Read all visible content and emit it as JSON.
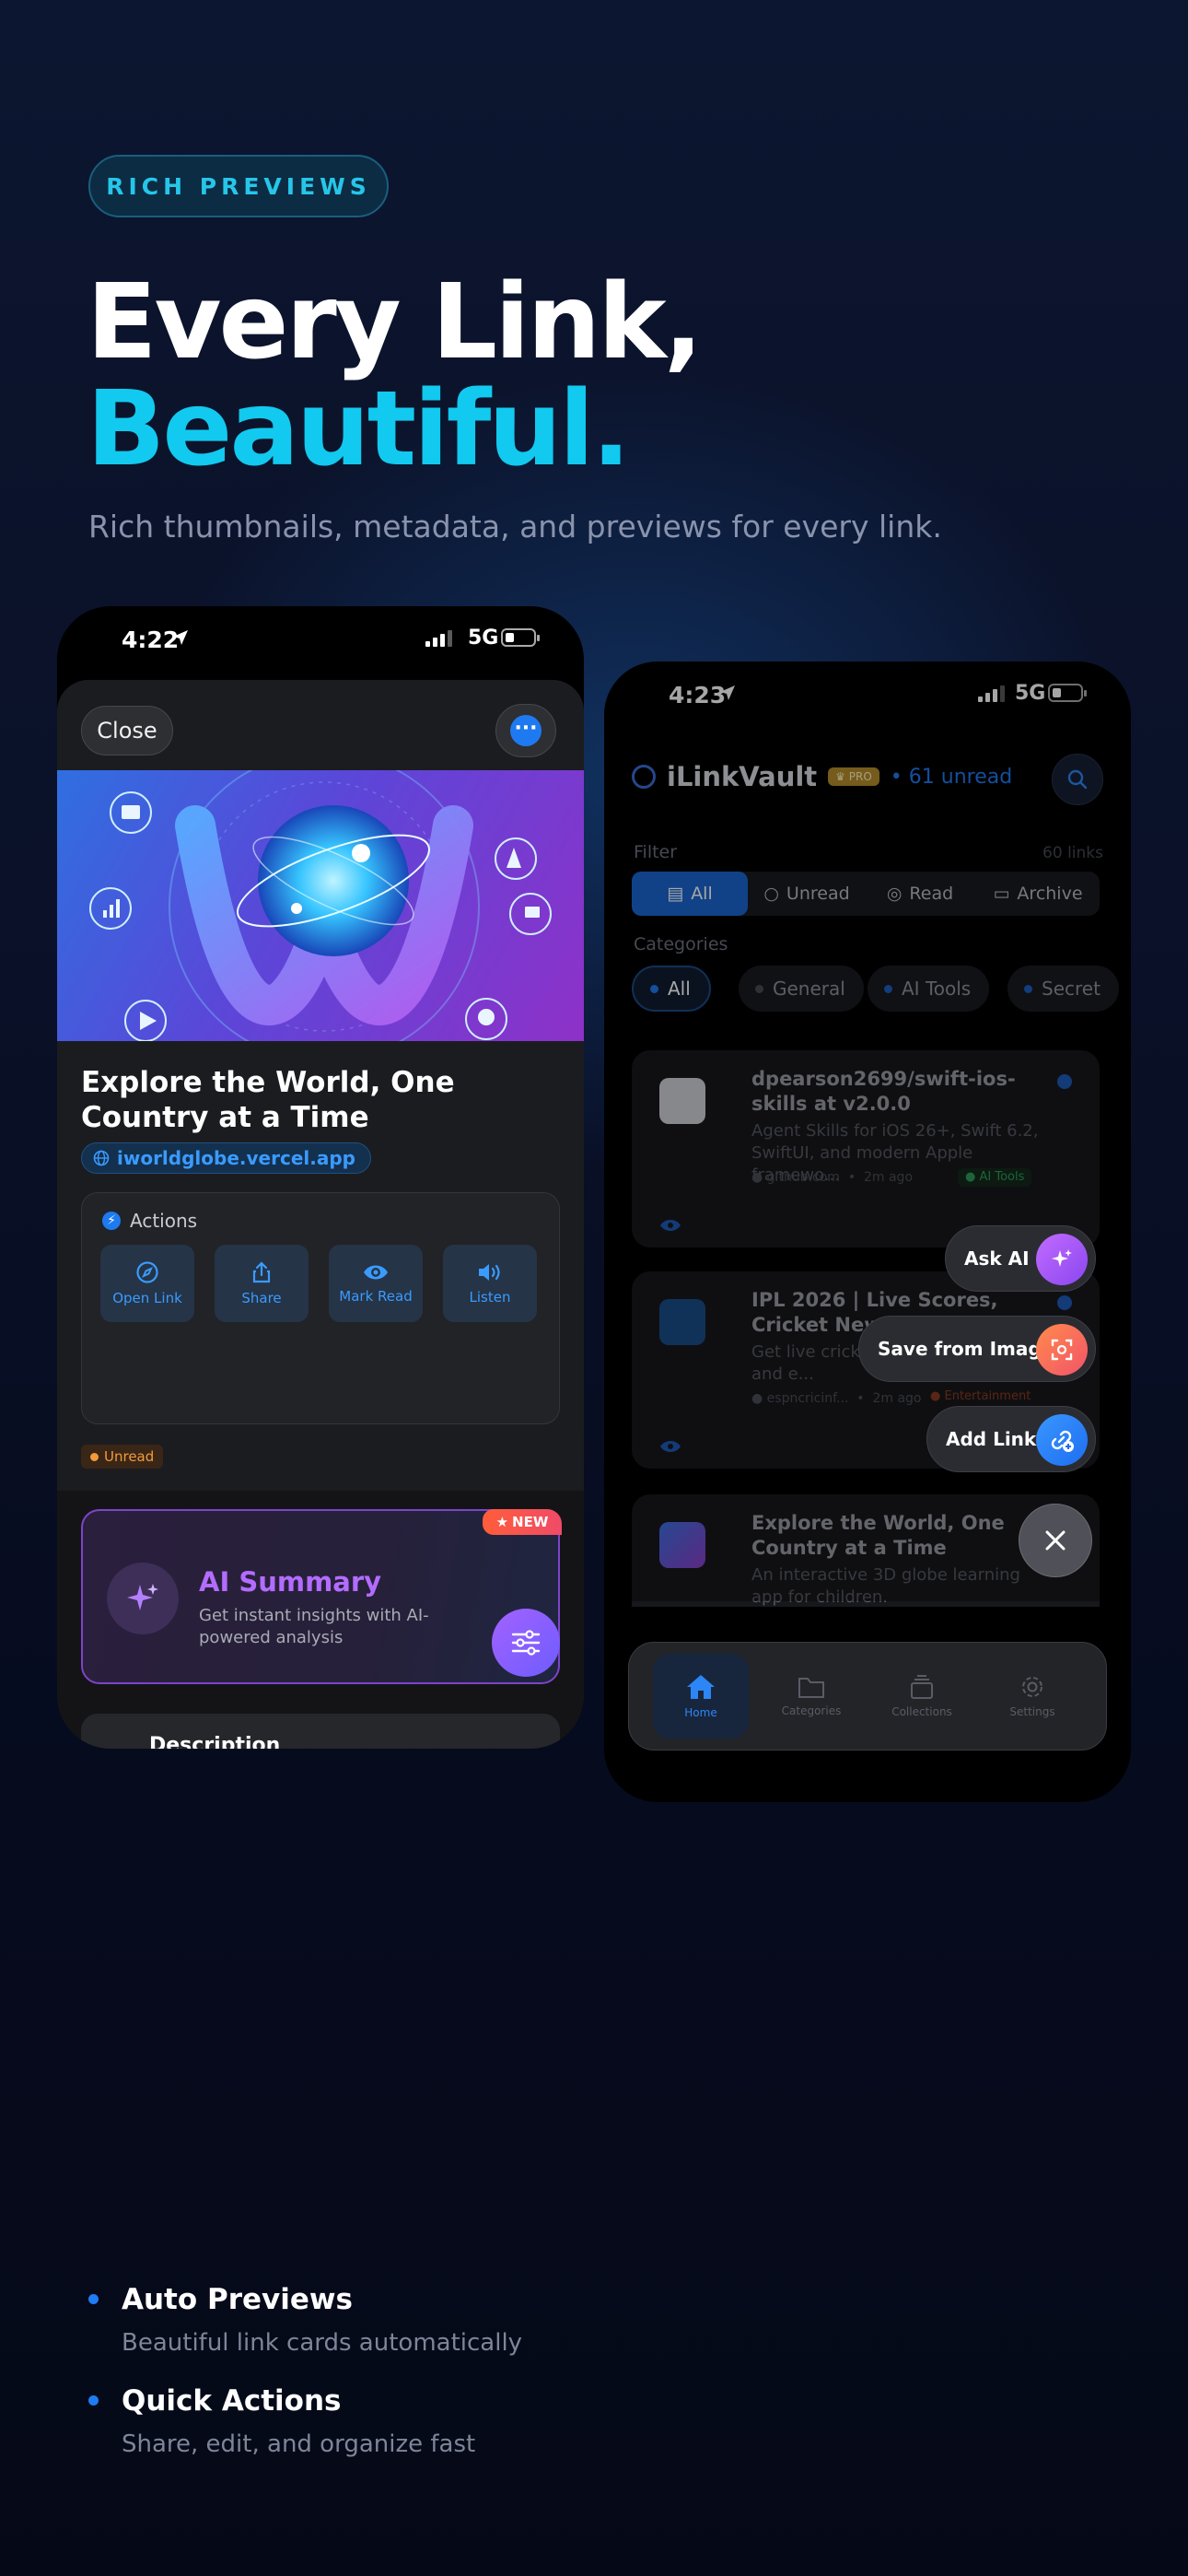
{
  "header": {
    "badge": "RICH PREVIEWS",
    "headline_line1": "Every Link,",
    "headline_line2": "Beautiful.",
    "subtitle": "Rich thumbnails, metadata, and previews for every link."
  },
  "phone_left": {
    "status": {
      "time": "4:22",
      "network": "5G"
    },
    "close_label": "Close",
    "link_title": "Explore the World, One Country at a Time",
    "domain": "iworldglobe.vercel.app",
    "actions_heading": "Actions",
    "actions": [
      {
        "label": "Open Link",
        "icon": "compass-icon"
      },
      {
        "label": "Share",
        "icon": "share-icon"
      },
      {
        "label": "Mark Read",
        "icon": "eye-icon"
      },
      {
        "label": "Listen",
        "icon": "speaker-icon"
      }
    ],
    "status_tag": "Unread",
    "ai_summary": {
      "badge": "NEW",
      "title": "AI Summary",
      "description": "Get instant insights with AI-powered analysis"
    },
    "next_section": "Description"
  },
  "phone_right": {
    "status": {
      "time": "4:23",
      "network": "5G"
    },
    "app_name": "iLinkVault",
    "plan_badge": "PRO",
    "unread_count": "61 unread",
    "filter_label": "Filter",
    "link_count": "60 links",
    "filters": [
      "All",
      "Unread",
      "Read",
      "Archive"
    ],
    "categories_label": "Categories",
    "categories": [
      {
        "label": "All",
        "color": "#1e7af0"
      },
      {
        "label": "General",
        "color": "#4a4c52"
      },
      {
        "label": "AI Tools",
        "color": "#1e5ec0"
      },
      {
        "label": "Secret",
        "color": "#1e5ec0"
      }
    ],
    "cards": [
      {
        "title": "dpearson2699/swift-ios-skills at v2.0.0",
        "description": "Agent Skills for iOS 26+, Swift 6.2, SwiftUI, and modern Apple framewo...",
        "source": "github.com",
        "time": "2m ago",
        "category": "AI Tools"
      },
      {
        "title": "IPL 2026 | Live Scores, Cricket News, Match Da...",
        "description": "Get live cricket sc... commentary, and e...",
        "source": "espncricinf...",
        "time": "2m ago",
        "category": "Entertainment"
      },
      {
        "title": "Explore the World, One Country at a Time",
        "description": "An interactive 3D globe learning app for children."
      }
    ],
    "fab_menu": [
      {
        "label": "Ask AI",
        "icon": "sparkles-icon",
        "color": "#a35cf0"
      },
      {
        "label": "Save from Image",
        "icon": "scan-icon",
        "color": "#f2673d"
      },
      {
        "label": "Add Link",
        "icon": "link-plus-icon",
        "color": "#1e7af0"
      }
    ],
    "tabs": [
      "Home",
      "Categories",
      "Collections",
      "Settings"
    ],
    "active_tab": "Home"
  },
  "features": [
    {
      "title": "Auto Previews",
      "text": "Beautiful link cards automatically"
    },
    {
      "title": "Quick Actions",
      "text": "Share, edit, and organize fast"
    }
  ]
}
